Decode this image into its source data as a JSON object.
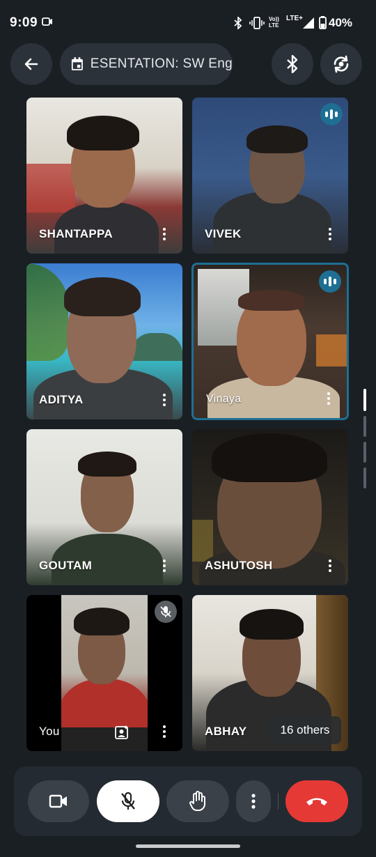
{
  "status_bar": {
    "time": "9:09",
    "battery": "40%",
    "icons": [
      "video-record-icon",
      "bluetooth-icon",
      "vibrate-icon",
      "volte-icon",
      "lte-icon",
      "signal-icon",
      "battery-icon"
    ],
    "volte_label": "Vo)) LTE",
    "lte_label": "LTE+"
  },
  "top_bar": {
    "back_icon": "arrow-back-icon",
    "calendar_icon": "calendar-icon",
    "meeting_title": "ESENTATION: SW Eng",
    "bluetooth_icon": "bluetooth-icon",
    "switch_camera_icon": "switch-camera-icon"
  },
  "participants": [
    {
      "name": "SHANTAPPA",
      "speaking": false
    },
    {
      "name": "VIVEK",
      "speaking": true
    },
    {
      "name": "ADITYA",
      "speaking": false
    },
    {
      "name": "Vinaya",
      "speaking": true,
      "active": true
    },
    {
      "name": "GOUTAM",
      "speaking": false
    },
    {
      "name": "ASHUTOSH",
      "speaking": false
    },
    {
      "name": "You",
      "muted": true,
      "effects_icon": "portrait-effects-icon"
    },
    {
      "name": "ABHAY",
      "others_label": "16 others"
    }
  ],
  "controls": {
    "camera_icon": "videocam-icon",
    "mic_icon": "mic-off-icon",
    "raise_hand_icon": "hand-icon",
    "more_icon": "more-vert-icon",
    "end_call_icon": "call-end-icon"
  },
  "colors": {
    "background": "#1a1f24",
    "button_dark": "#2b323a",
    "mic_button": "#ffffff",
    "end_call": "#e53935",
    "speaking_accent": "#1e6f93"
  }
}
